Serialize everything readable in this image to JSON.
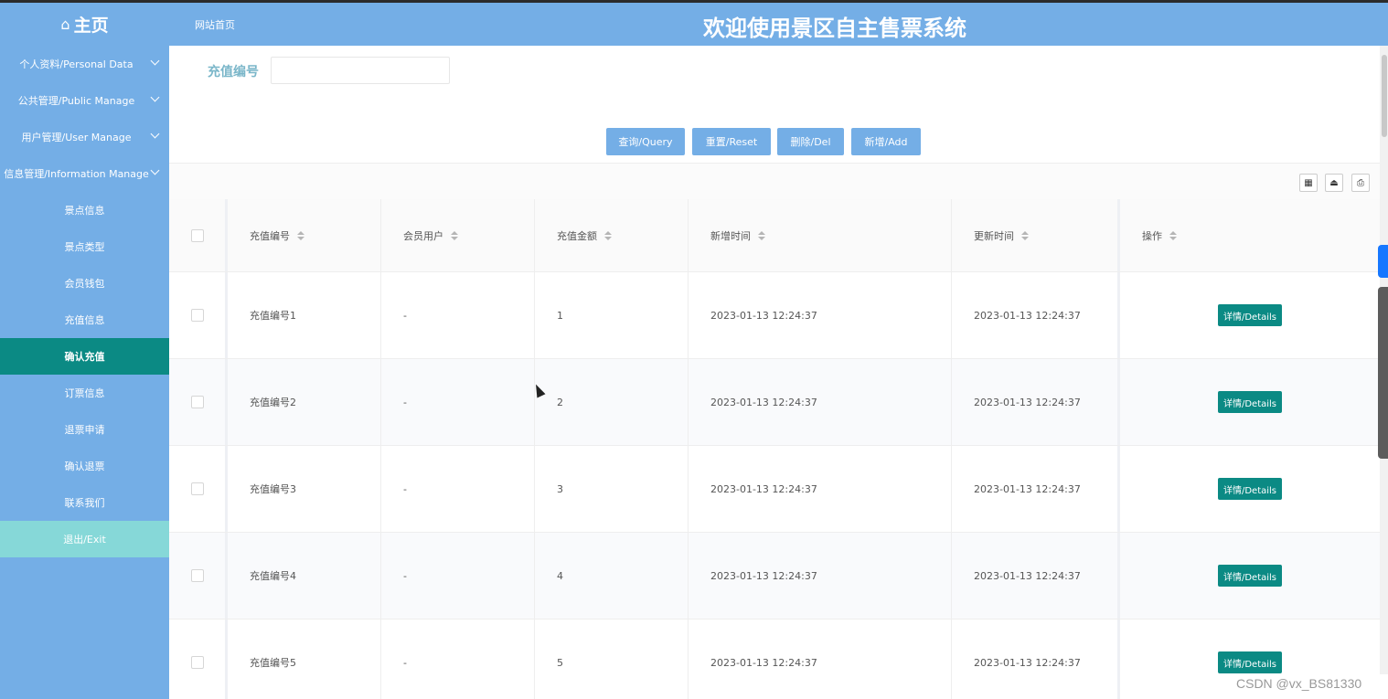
{
  "header": {
    "home_icon": "home-icon",
    "home_label": "主页",
    "site_link": "网站首页",
    "title": "欢迎使用景区自主售票系统"
  },
  "sidebar": {
    "groups": [
      {
        "label": "个人资料/Personal Data"
      },
      {
        "label": "公共管理/Public Manage"
      },
      {
        "label": "用户管理/User Manage"
      },
      {
        "label": "信息管理/Information Manage"
      }
    ],
    "items": [
      {
        "label": "景点信息"
      },
      {
        "label": "景点类型"
      },
      {
        "label": "会员钱包"
      },
      {
        "label": "充值信息"
      },
      {
        "label": "确认充值"
      },
      {
        "label": "订票信息"
      },
      {
        "label": "退票申请"
      },
      {
        "label": "确认退票"
      },
      {
        "label": "联系我们"
      },
      {
        "label": "退出/Exit"
      }
    ],
    "active_item": "确认充值"
  },
  "search": {
    "label": "充值编号",
    "value": "",
    "placeholder": ""
  },
  "buttons": {
    "query": "查询/Query",
    "reset": "重置/Reset",
    "delete": "删除/Del",
    "add": "新增/Add"
  },
  "toolbar": {
    "icons": [
      "columns-icon",
      "export-icon",
      "print-icon"
    ]
  },
  "table": {
    "columns": [
      "充值编号",
      "会员用户",
      "充值金额",
      "新增时间",
      "更新时间",
      "操作"
    ],
    "rows": [
      {
        "code": "充值编号1",
        "user": "-",
        "amount": "1",
        "created": "2023-01-13 12:24:37",
        "updated": "2023-01-13 12:24:37",
        "action": "详情/Details"
      },
      {
        "code": "充值编号2",
        "user": "-",
        "amount": "2",
        "created": "2023-01-13 12:24:37",
        "updated": "2023-01-13 12:24:37",
        "action": "详情/Details"
      },
      {
        "code": "充值编号3",
        "user": "-",
        "amount": "3",
        "created": "2023-01-13 12:24:37",
        "updated": "2023-01-13 12:24:37",
        "action": "详情/Details"
      },
      {
        "code": "充值编号4",
        "user": "-",
        "amount": "4",
        "created": "2023-01-13 12:24:37",
        "updated": "2023-01-13 12:24:37",
        "action": "详情/Details"
      },
      {
        "code": "充值编号5",
        "user": "-",
        "amount": "5",
        "created": "2023-01-13 12:24:37",
        "updated": "2023-01-13 12:24:37",
        "action": "详情/Details"
      }
    ]
  },
  "watermark": "CSDN @vx_BS81330",
  "colors": {
    "primary": "#74aee6",
    "accent": "#0b8a84",
    "exit": "#86d8d8"
  }
}
